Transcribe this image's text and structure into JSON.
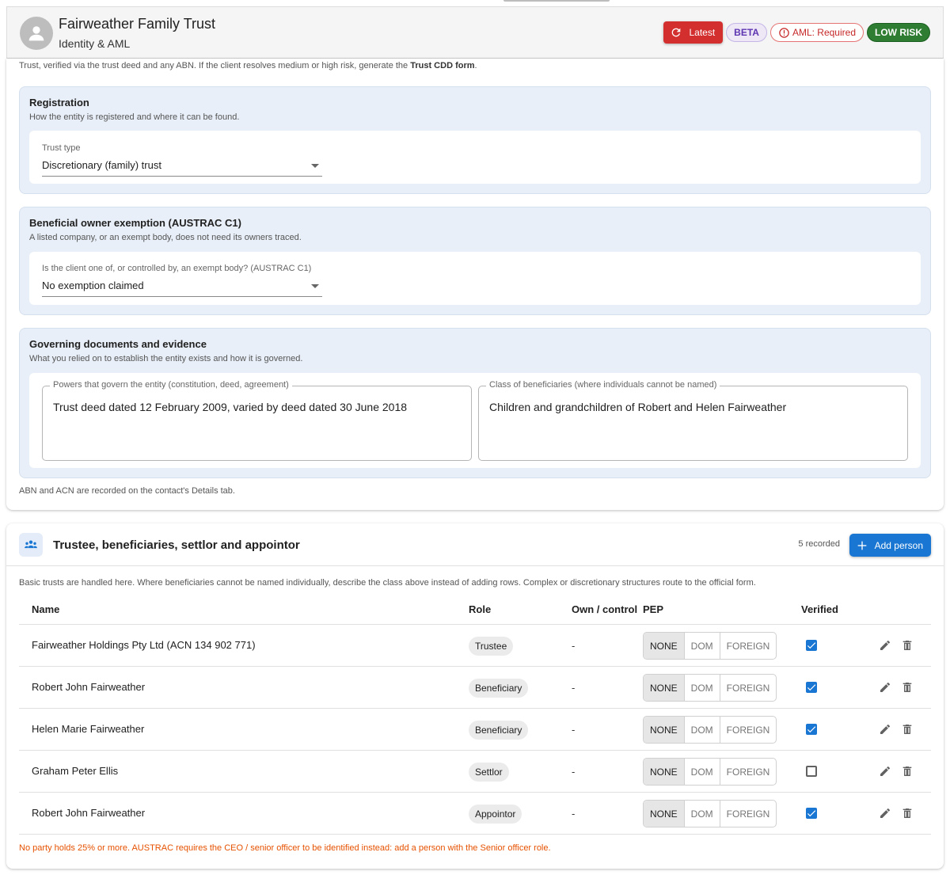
{
  "header": {
    "title": "Fairweather Family Trust",
    "subtitle": "Identity & AML",
    "latest_label": "Latest",
    "beta_label": "BETA",
    "aml_label": "AML: Required",
    "risk_label": "LOW RISK",
    "colors": {
      "latest": "#d32f2f",
      "risk": "#2e7d32",
      "beta": "#5e35b1",
      "aml": "#c62828"
    }
  },
  "intro": {
    "text": "Trust, verified via the trust deed and any ABN. If the client resolves medium or high risk, generate the ",
    "bold": "Trust CDD form",
    "end": "."
  },
  "registration": {
    "title": "Registration",
    "description": "How the entity is registered and where it can be found.",
    "field_label": "Trust type",
    "field_value": "Discretionary (family) trust"
  },
  "exemption": {
    "title": "Beneficial owner exemption (AUSTRAC C1)",
    "description": "A listed company, or an exempt body, does not need its owners traced.",
    "field_label": "Is the client one of, or controlled by, an exempt body? (AUSTRAC C1)",
    "field_value": "No exemption claimed"
  },
  "governing": {
    "title": "Governing documents and evidence",
    "description": "What you relied on to establish the entity exists and how it is governed.",
    "powers_label": "Powers that govern the entity (constitution, deed, agreement)",
    "powers_value": "Trust deed dated 12 February 2009, varied by deed dated 30 June 2018",
    "class_label": "Class of beneficiaries (where individuals cannot be named)",
    "class_value": "Children and grandchildren of Robert and Helen Fairweather"
  },
  "abn_note": "ABN and ACN are recorded on the contact's Details tab.",
  "people": {
    "title": "Trustee, beneficiaries, settlor and appointor",
    "recorded": "5 recorded",
    "add_label": "Add person",
    "note": "Basic trusts are handled here. Where beneficiaries cannot be named individually, describe the class above instead of adding rows. Complex or discretionary structures route to the official form.",
    "columns": {
      "name": "Name",
      "role": "Role",
      "own": "Own / control",
      "pep": "PEP",
      "verified": "Verified"
    },
    "pep_options": [
      "NONE",
      "DOM",
      "FOREIGN"
    ],
    "rows": [
      {
        "name": "Fairweather Holdings Pty Ltd (ACN 134 902 771)",
        "role": "Trustee",
        "own": "-",
        "pep": "NONE",
        "verified": true
      },
      {
        "name": "Robert John Fairweather",
        "role": "Beneficiary",
        "own": "-",
        "pep": "NONE",
        "verified": true
      },
      {
        "name": "Helen Marie Fairweather",
        "role": "Beneficiary",
        "own": "-",
        "pep": "NONE",
        "verified": true
      },
      {
        "name": "Graham Peter Ellis",
        "role": "Settlor",
        "own": "-",
        "pep": "NONE",
        "verified": false
      },
      {
        "name": "Robert John Fairweather",
        "role": "Appointor",
        "own": "-",
        "pep": "NONE",
        "verified": true
      }
    ],
    "warning": "No party holds 25% or more. AUSTRAC requires the CEO / senior officer to be identified instead: add a person with the Senior officer role."
  }
}
